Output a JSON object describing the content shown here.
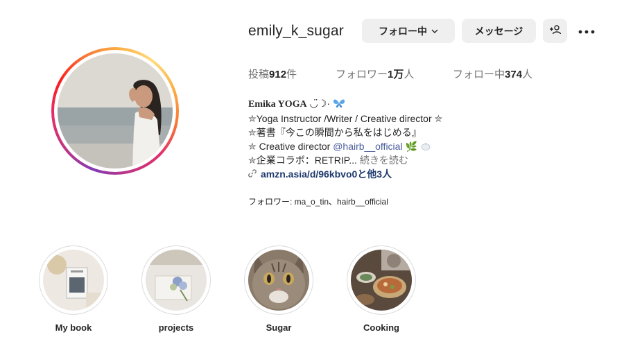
{
  "profile": {
    "username": "emily_k_sugar",
    "buttons": {
      "following_label": "フォロー中",
      "message_label": "メッセージ",
      "suggest_icon": "add-person-icon",
      "more_icon": "more-options-icon"
    },
    "stats": {
      "posts_label": "投稿",
      "posts_count": "912",
      "posts_unit": "件",
      "followers_label": "フォロワー",
      "followers_count": "1万",
      "followers_unit": "人",
      "following_label": "フォロー中",
      "following_count": "374",
      "following_unit": "人"
    }
  },
  "bio": {
    "name": "Emika YOGA",
    "name_emoji": "◡̈☽·",
    "lines": [
      "Yoga Instructor /Writer / Creative director",
      "著書『今この瞬間から私をはじめる』",
      "Creative director ",
      "企業コラボ：RETRIP..."
    ],
    "mention": "@hairb__official",
    "read_more": "続きを読む",
    "link": "amzn.asia/d/96kbvo0と他3人",
    "followed_by_label": "フォロワー: ",
    "followed_by_names": "ma_o_tin、hairb__official"
  },
  "highlights": [
    {
      "label": "My book"
    },
    {
      "label": "projects"
    },
    {
      "label": "Sugar"
    },
    {
      "label": "Cooking"
    }
  ],
  "colors": {
    "button_bg": "#efefef",
    "text": "#262626",
    "muted": "#737373",
    "link": "#1f3a6d",
    "mention": "#4a5d9e"
  }
}
